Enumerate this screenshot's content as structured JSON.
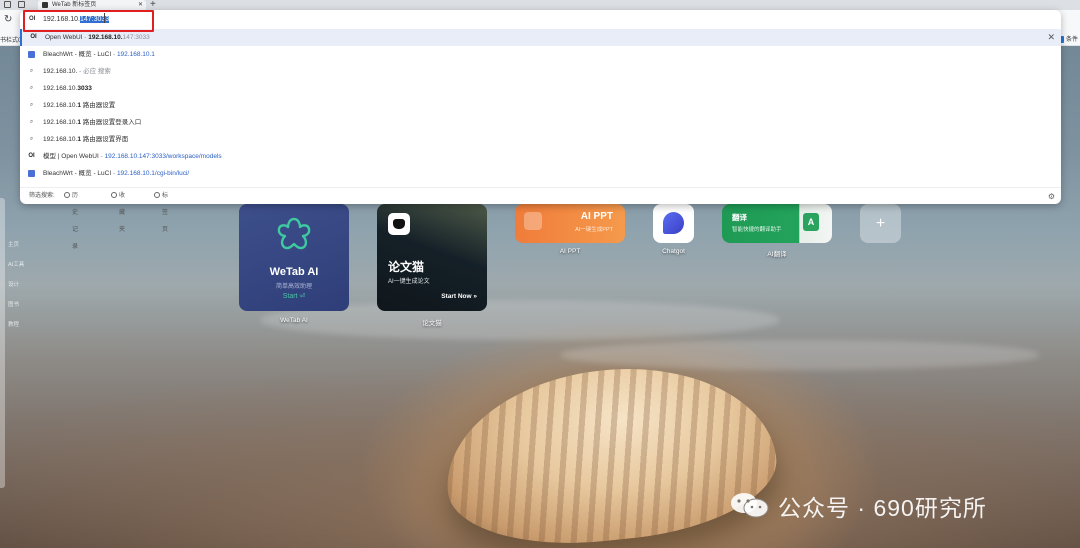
{
  "browser": {
    "tab_title": "WeTab 新标签页",
    "tab_close": "✕",
    "new_tab": "+",
    "reload": "↻",
    "bookmarks_left": "书栏式0.1",
    "bookmarks_right": "条件"
  },
  "omnibox": {
    "address_icon": "OI",
    "address_typed": "192.168.10.",
    "address_selected": "147:3033",
    "suggestions": [
      {
        "icon": "OI",
        "parts": [
          {
            "t": "Open WebUI"
          },
          {
            "t": " - ",
            "c": "dim"
          },
          {
            "t": "192.168.10.",
            "c": "b"
          },
          {
            "t": "147:3033",
            "c": "dim"
          }
        ]
      },
      {
        "icon": "site",
        "parts": [
          {
            "t": "BleachWrt - 概览 - LuCI"
          },
          {
            "t": " - ",
            "c": "dim"
          },
          {
            "t": "192.168.10.",
            "c": "link"
          },
          {
            "t": "1",
            "c": "link"
          }
        ]
      },
      {
        "icon": "search",
        "parts": [
          {
            "t": "192.168.10."
          },
          {
            "t": " - 必应 搜索",
            "c": "dim"
          }
        ]
      },
      {
        "icon": "search",
        "parts": [
          {
            "t": "192.168.10."
          },
          {
            "t": "3033",
            "c": "b"
          }
        ]
      },
      {
        "icon": "search",
        "parts": [
          {
            "t": "192.168.10."
          },
          {
            "t": "1",
            "c": "b"
          },
          {
            "t": " 路由器设置"
          }
        ]
      },
      {
        "icon": "search",
        "parts": [
          {
            "t": "192.168.10."
          },
          {
            "t": "1",
            "c": "b"
          },
          {
            "t": " 路由器设置登录入口"
          }
        ]
      },
      {
        "icon": "search",
        "parts": [
          {
            "t": "192.168.10."
          },
          {
            "t": "1",
            "c": "b"
          },
          {
            "t": " 路由器设置界面"
          }
        ]
      },
      {
        "icon": "OI",
        "parts": [
          {
            "t": "模型 | Open WebUI"
          },
          {
            "t": " - ",
            "c": "dim"
          },
          {
            "t": "192.168.10.",
            "c": "link"
          },
          {
            "t": "147:3033/workspace/models",
            "c": "link"
          }
        ]
      },
      {
        "icon": "site",
        "parts": [
          {
            "t": "BleachWrt - 概览 - LuCI"
          },
          {
            "t": " - ",
            "c": "dim"
          },
          {
            "t": "192.168.10.",
            "c": "link"
          },
          {
            "t": "1/cgi-bin/luci/",
            "c": "link"
          }
        ]
      }
    ],
    "suggestion_remove": "✕",
    "footer": {
      "search_label": "筛选搜索:",
      "history_label": "历史记录",
      "favorites_label": "收藏夹",
      "tabs_label": "标签页",
      "settings_icon": "⚙"
    }
  },
  "sidebar": {
    "labels": [
      "主页",
      "AI工具",
      "设计",
      "图书",
      "教程"
    ]
  },
  "tiles": {
    "wetab": {
      "title": "WeTab AI",
      "subtitle": "简单高效助理",
      "start": "Start ⏎",
      "caption": "WeTab AI"
    },
    "paper": {
      "title": "论文猫",
      "subtitle": "AI一键生成论文",
      "start": "Start Now »",
      "caption": "论文猫"
    },
    "ppt": {
      "title": "AI PPT",
      "subtitle": "AI一键生成PPT",
      "caption": "AI PPT"
    },
    "chatgot": {
      "caption": "Chatgot"
    },
    "translate": {
      "title": "翻译",
      "subtitle": "智能快捷的翻译助手",
      "icon_letter": "A",
      "caption": "AI翻译"
    },
    "add": {
      "plus": "+"
    }
  },
  "watermark": {
    "text": "公众号 · 690研究所"
  },
  "colors": {
    "accent": "#2b6fd6",
    "highlight_box": "#e02020"
  }
}
